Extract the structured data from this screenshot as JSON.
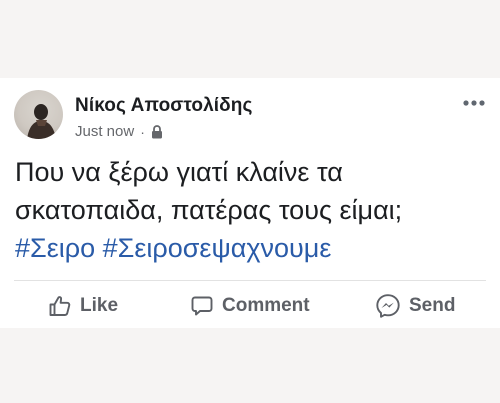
{
  "post": {
    "author_name": "Νίκος Αποστολίδης",
    "timestamp": "Just now",
    "separator": "·",
    "privacy_icon": "lock-icon",
    "more_icon": "more-options-icon",
    "text_lines": [
      "Που να ξέρω γιατί κλαίνε τα",
      "σκατοπαιδα, πατέρας τους είμαι;"
    ],
    "hashtags": [
      "#Σειρο",
      "#Σειροσεψαχνουμε"
    ],
    "hashtag_color": "#2a5ba8"
  },
  "actions": {
    "like_label": "Like",
    "comment_label": "Comment",
    "send_label": "Send",
    "like_icon": "thumbs-up-icon",
    "comment_icon": "comment-bubble-icon",
    "send_icon": "messenger-icon"
  },
  "colors": {
    "background": "#f6f4f3",
    "card": "#ffffff",
    "text": "#1c1e21",
    "muted": "#65676b",
    "action_text": "#5d6066"
  }
}
